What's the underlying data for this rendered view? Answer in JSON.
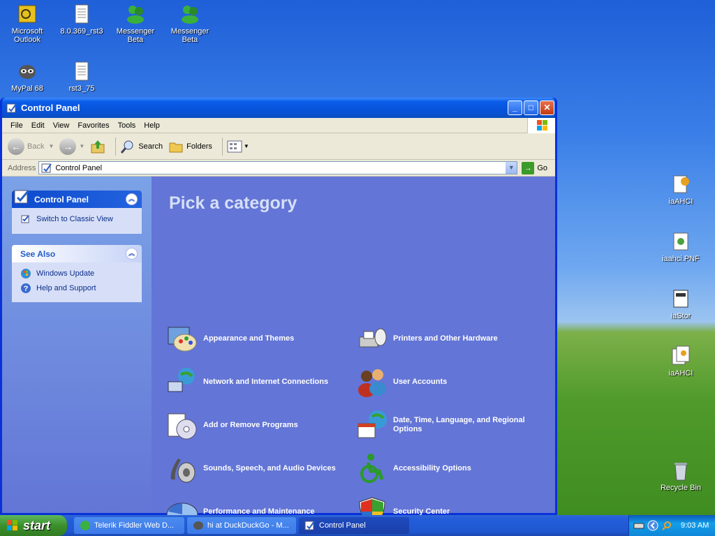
{
  "desktop": {
    "icons_left": [
      {
        "label": "Microsoft Outlook",
        "icon": "outlook-icon"
      },
      {
        "label": "8.0.369_rst3",
        "icon": "text-file-icon"
      },
      {
        "label": "Messenger Beta",
        "icon": "messenger-icon"
      },
      {
        "label": "Messenger Beta",
        "icon": "messenger-icon"
      },
      {
        "label": "MyPal 68",
        "icon": "mypal-icon"
      },
      {
        "label": "rst3_75",
        "icon": "text-file-icon"
      }
    ],
    "icons_right": [
      {
        "label": "iaAHCI",
        "icon": "installer-icon"
      },
      {
        "label": "iaahci.PNF",
        "icon": "pnf-file-icon"
      },
      {
        "label": "iaStor",
        "icon": "config-file-icon"
      },
      {
        "label": "iaAHCI",
        "icon": "installer-icon"
      },
      {
        "label": "Recycle Bin",
        "icon": "recycle-bin-icon"
      }
    ]
  },
  "window": {
    "title": "Control Panel",
    "menu": [
      "File",
      "Edit",
      "View",
      "Favorites",
      "Tools",
      "Help"
    ],
    "toolbar": {
      "back": "Back",
      "search": "Search",
      "folders": "Folders"
    },
    "address": {
      "label": "Address",
      "value": "Control Panel",
      "go": "Go"
    }
  },
  "sidebar": {
    "control_panel": {
      "title": "Control Panel",
      "switch_link": "Switch to Classic View"
    },
    "see_also": {
      "title": "See Also",
      "links": [
        "Windows Update",
        "Help and Support"
      ]
    }
  },
  "main": {
    "heading": "Pick a category",
    "categories": [
      {
        "label": "Appearance and Themes",
        "icon": "appearance-icon"
      },
      {
        "label": "Printers and Other Hardware",
        "icon": "printer-icon"
      },
      {
        "label": "Network and Internet Connections",
        "icon": "network-icon"
      },
      {
        "label": "User Accounts",
        "icon": "user-accounts-icon"
      },
      {
        "label": "Add or Remove Programs",
        "icon": "add-remove-programs-icon"
      },
      {
        "label": "Date, Time, Language, and Regional Options",
        "icon": "date-time-icon"
      },
      {
        "label": "Sounds, Speech, and Audio Devices",
        "icon": "sounds-icon"
      },
      {
        "label": "Accessibility Options",
        "icon": "accessibility-icon"
      },
      {
        "label": "Performance and Maintenance",
        "icon": "performance-icon"
      },
      {
        "label": "Security Center",
        "icon": "security-shield-icon"
      }
    ]
  },
  "taskbar": {
    "start": "start",
    "tasks": [
      "Telerik Fiddler Web D...",
      "hi at DuckDuckGo - M...",
      "Control Panel"
    ],
    "clock": "9:03 AM"
  }
}
